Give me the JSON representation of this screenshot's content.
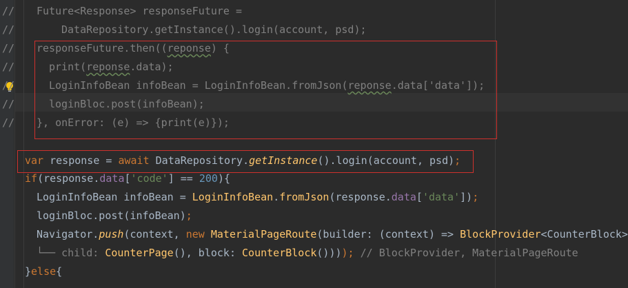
{
  "gutter_marks": [
    "//",
    "//",
    "//",
    "//",
    "//",
    "//",
    "//"
  ],
  "comment_lines": [
    "Future<Response> responseFuture =",
    "DataRepository.getInstance().login(account, psd);",
    "responseFuture.then((",
    "reponse",
    ") {",
    "print(",
    ".data);",
    "LoginInfoBean infoBean = LoginInfoBean.fromJson(",
    ".data['data']);",
    "loginBloc.post(infoBean);",
    "}, onError: (e) => {print(e)});"
  ],
  "code": {
    "l1_var": "var",
    "l1_a": " response = ",
    "l1_await": "await",
    "l1_b": " DataRepository.",
    "l1_getInstance": "getInstance",
    "l1_c": "().login(account, psd)",
    "l1_semi": ";",
    "l2_if": "if",
    "l2_a": "(response.",
    "l2_data": "data",
    "l2_b": "[",
    "l2_code": "'code'",
    "l2_c": "] == ",
    "l2_num": "200",
    "l2_d": "){",
    "l3_a": "LoginInfoBean infoBean = ",
    "l3_cls": "LoginInfoBean",
    "l3_b": ".",
    "l3_fromJson": "fromJson",
    "l3_c": "(response.",
    "l3_data": "data",
    "l3_d": "[",
    "l3_str": "'data'",
    "l3_e": "])",
    "l3_semi": ";",
    "l4_a": "loginBloc.post(infoBean)",
    "l4_semi": ";",
    "l5_a": "Navigator.",
    "l5_push": "push",
    "l5_b": "(context, ",
    "l5_new": "new",
    "l5_sp": " ",
    "l5_mpr": "MaterialPageRoute",
    "l5_c": "(builder: (context) => ",
    "l5_bp": "BlockProvider",
    "l5_d": "<CounterBlock>",
    "l6_tree": "└── child: ",
    "l6_cp": "CounterPage",
    "l6_a": "(), block: ",
    "l6_cb": "CounterBlock",
    "l6_b": "()))",
    "l6_semi": ");",
    "l6_hint": " // BlockProvider, MaterialPageRoute",
    "l7_a": "}",
    "l7_else": "else",
    "l7_b": "{"
  }
}
